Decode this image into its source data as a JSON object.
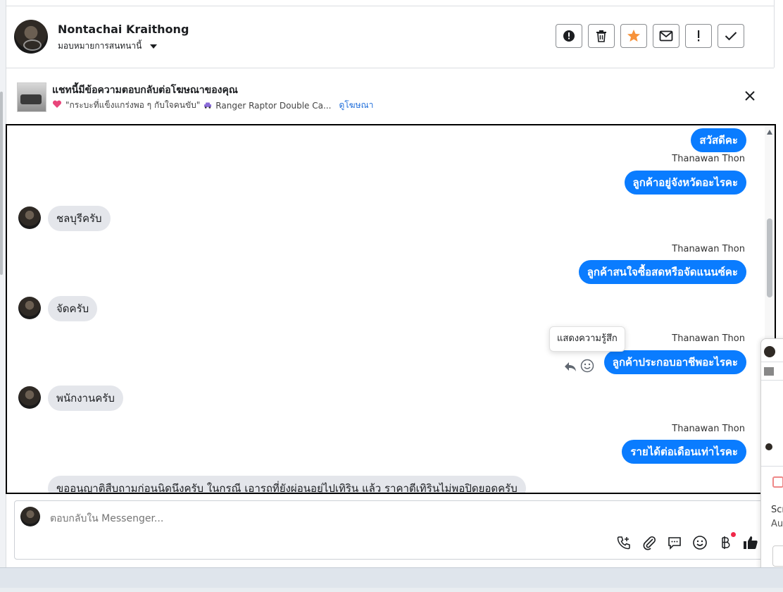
{
  "header": {
    "contact_name": "Nontachai Kraithong",
    "assign_label": "มอบหมายการสนทนานี้",
    "actions": [
      {
        "name": "report-spam-button",
        "icon": "alert-circle-icon"
      },
      {
        "name": "delete-button",
        "icon": "trash-icon"
      },
      {
        "name": "star-button",
        "icon": "star-icon"
      },
      {
        "name": "mark-unread-button",
        "icon": "envelope-icon"
      },
      {
        "name": "mark-important-button",
        "icon": "exclamation-icon"
      },
      {
        "name": "mark-done-button",
        "icon": "check-icon"
      }
    ]
  },
  "ad": {
    "title": "แชทนี้มีข้อความตอบกลับต่อโฆษณาของคุณ",
    "subtitle": "\"กระบะที่แข็งแกร่งพอ ๆ กับใจคนขับ\"",
    "product": "Ranger Raptor Double Ca...",
    "link": "ดูโฆษณา"
  },
  "messages": [
    {
      "dir": "out",
      "text": "สวัสดีคะ"
    },
    {
      "dir": "out",
      "sender": "Thanawan Thon",
      "text": "ลูกค้าอยู่จังหวัดอะไรคะ"
    },
    {
      "dir": "in",
      "text": "ชลบุรีครับ"
    },
    {
      "dir": "out",
      "sender": "Thanawan Thon",
      "text": "ลูกค้าสนใจซื้อสดหรือจัดแนนซ์คะ"
    },
    {
      "dir": "in",
      "text": "จัดครับ"
    },
    {
      "dir": "out",
      "sender": "Thanawan Thon",
      "text": "ลูกค้าประกอบอาชีพอะไรคะ"
    },
    {
      "dir": "in",
      "text": "พนักงานครับ"
    },
    {
      "dir": "out",
      "sender": "Thanawan Thon",
      "text": "รายได้ต่อเดือนเท่าไรคะ"
    },
    {
      "dir": "in",
      "text": "ขออนุญาติสืบถามก่อนนิดนึงครับ ในกรณี เอารถที่ยังผ่อนอยู่ไปเทิริน แล้ว ราคาตีเทิรินไม่พอปิดยอดครับ"
    }
  ],
  "tooltip": "แสดงความรู้สึก",
  "composer": {
    "placeholder": "ตอบกลับใน Messenger..."
  },
  "popup": {
    "text1": "Scr",
    "text2": "Au"
  },
  "colors": {
    "accent": "#0a7cff",
    "incoming_bubble": "#e4e6eb",
    "star": "#f7923a",
    "link": "#216fdb"
  }
}
